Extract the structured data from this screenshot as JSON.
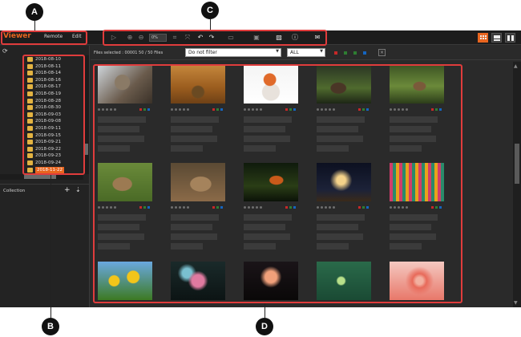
{
  "callouts": {
    "a": "A",
    "b": "B",
    "c": "C",
    "d": "D"
  },
  "header": {
    "brand": "Viewer",
    "menu": [
      {
        "label": "Remote"
      },
      {
        "label": "Edit"
      }
    ],
    "zoom": "0%"
  },
  "sidebar": {
    "folders": [
      {
        "label": "2018-08-10"
      },
      {
        "label": "2018-08-11"
      },
      {
        "label": "2018-08-14"
      },
      {
        "label": "2018-08-16"
      },
      {
        "label": "2018-08-17"
      },
      {
        "label": "2018-08-19"
      },
      {
        "label": "2018-08-28"
      },
      {
        "label": "2018-08-30"
      },
      {
        "label": "2018-09-03"
      },
      {
        "label": "2018-09-08"
      },
      {
        "label": "2018-09-11"
      },
      {
        "label": "2018-09-15"
      },
      {
        "label": "2018-09-21"
      },
      {
        "label": "2018-09-22"
      },
      {
        "label": "2018-09-23"
      },
      {
        "label": "2018-09-24"
      },
      {
        "label": "2018-11-22"
      }
    ],
    "selected_index": 16,
    "collection_label": "Collection"
  },
  "filterbar": {
    "files_selected": "Files selected : 00001   50 / 50 Files",
    "filter_select": "Do not filter",
    "scope_select": "ALL",
    "label_colors": [
      "#c62828",
      "#2e7d32",
      "#2e7d32",
      "#1565c0"
    ]
  },
  "colors": {
    "accent": "#e8651f",
    "callout": "#e03c3c"
  },
  "thumbnails": [
    {
      "subject": "owl"
    },
    {
      "subject": "field"
    },
    {
      "subject": "fox"
    },
    {
      "subject": "deer-buck"
    },
    {
      "subject": "deer-forest"
    },
    {
      "subject": "doe"
    },
    {
      "subject": "deer-fawn"
    },
    {
      "subject": "squirrel"
    },
    {
      "subject": "fireworks-city"
    },
    {
      "subject": "flags"
    },
    {
      "subject": "sunflowers"
    },
    {
      "subject": "bokeh"
    },
    {
      "subject": "fireworks"
    },
    {
      "subject": "green-flower"
    },
    {
      "subject": "dahlia"
    }
  ]
}
